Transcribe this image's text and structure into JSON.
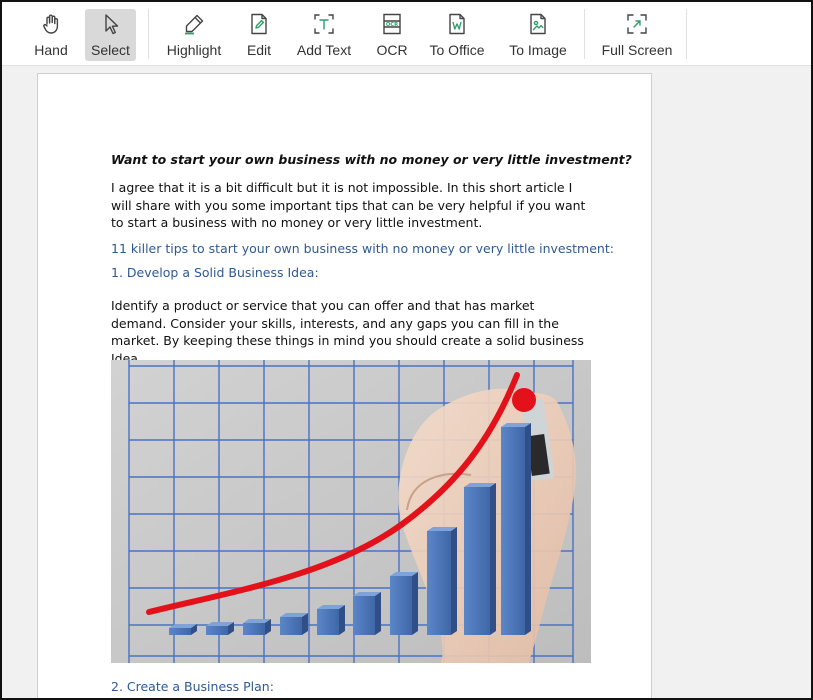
{
  "toolbar": {
    "tools": [
      {
        "label": "Hand",
        "icon": "hand-icon"
      },
      {
        "label": "Select",
        "icon": "cursor-icon",
        "selected": true
      },
      {
        "label": "Highlight",
        "icon": "highlighter-icon"
      },
      {
        "label": "Edit",
        "icon": "edit-document-icon"
      },
      {
        "label": "Add Text",
        "icon": "add-text-icon"
      },
      {
        "label": "OCR",
        "icon": "ocr-icon"
      },
      {
        "label": "To Office",
        "icon": "word-document-icon"
      },
      {
        "label": "To Image",
        "icon": "image-convert-icon"
      },
      {
        "label": "Full Screen",
        "icon": "fullscreen-icon"
      }
    ],
    "accent_color": "#2e9e6b"
  },
  "document": {
    "title": "Want to start your own business with no money or very little investment?",
    "intro": "I agree that it is a bit difficult but it is not impossible. In this short article I will share with you some important tips that can be very helpful if you want to start a business with no money or very little investment.",
    "tips_heading": "11 killer tips to start your own business with no money or very little investment:",
    "section1_heading": "1. Develop a Solid Business Idea:",
    "section1_body": "Identify a product or service that you can offer and that has market demand. Consider your skills, interests, and any gaps you can fill in the market. By keeping these things in mind you should create a solid business Idea.",
    "section2_heading": "2. Create a Business Plan:",
    "heading_color": "#2e5a92"
  }
}
